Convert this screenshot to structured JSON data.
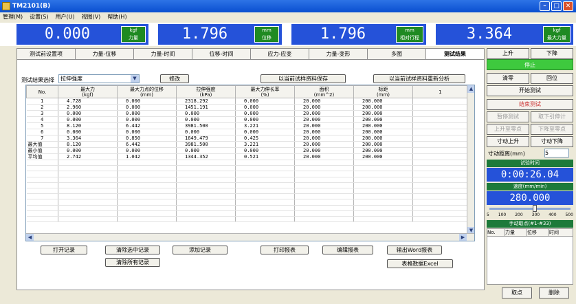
{
  "window": {
    "title": "TM2101(B)"
  },
  "menu": [
    "管理(M)",
    "设置(S)",
    "用户(U)",
    "视图(V)",
    "帮助(H)"
  ],
  "readouts": [
    {
      "value": "0.000",
      "unit_top": "kgf",
      "unit_bottom": "力量"
    },
    {
      "value": "1.796",
      "unit_top": "mm",
      "unit_bottom": "位移"
    },
    {
      "value": "1.796",
      "unit_top": "mm",
      "unit_bottom": "相对行程"
    },
    {
      "value": "3.364",
      "unit_top": "kgf",
      "unit_bottom": "最大力量"
    }
  ],
  "tabs": [
    "测试前设置项",
    "力量-位移",
    "力量-时间",
    "位移-时间",
    "应力-应变",
    "力量-变形",
    "多图",
    "测试结果"
  ],
  "active_tab": 7,
  "result_select": {
    "label": "测试结果选择",
    "value": "拉伸强度",
    "modify_button": "修改"
  },
  "top_buttons": {
    "save_params": "以当前试样资料保存",
    "reanalyze": "以当前试样资料重新分析"
  },
  "table": {
    "columns": [
      {
        "top": "No.",
        "bottom": ""
      },
      {
        "top": "最大力",
        "bottom": "(kgf)"
      },
      {
        "top": "最大力点的位移",
        "bottom": "(mm)"
      },
      {
        "top": "拉伸强度",
        "bottom": "(kPa)"
      },
      {
        "top": "最大力伸长率",
        "bottom": "(%)"
      },
      {
        "top": "面积",
        "bottom": "(mm^2)"
      },
      {
        "top": "标距",
        "bottom": "(mm)"
      },
      {
        "top": "1",
        "bottom": ""
      }
    ],
    "rows": [
      [
        "1",
        "4.728",
        "0.000",
        "2318.292",
        "0.000",
        "20.000",
        "200.000",
        ""
      ],
      [
        "2",
        "2.960",
        "0.000",
        "1451.191",
        "0.000",
        "20.000",
        "200.000",
        ""
      ],
      [
        "3",
        "0.000",
        "0.000",
        "0.000",
        "0.000",
        "20.000",
        "200.000",
        ""
      ],
      [
        "4",
        "0.000",
        "0.000",
        "0.000",
        "0.000",
        "20.000",
        "200.000",
        ""
      ],
      [
        "5",
        "8.120",
        "6.442",
        "3981.500",
        "3.221",
        "20.000",
        "200.000",
        ""
      ],
      [
        "6",
        "0.000",
        "0.000",
        "0.000",
        "0.000",
        "20.000",
        "200.000",
        ""
      ],
      [
        "7",
        "3.364",
        "0.850",
        "1649.479",
        "0.425",
        "20.000",
        "200.000",
        ""
      ],
      [
        "最大值",
        "8.120",
        "6.442",
        "3981.500",
        "3.221",
        "20.000",
        "200.000",
        ""
      ],
      [
        "最小值",
        "0.000",
        "0.000",
        "0.000",
        "0.000",
        "20.000",
        "200.000",
        ""
      ],
      [
        "平均值",
        "2.742",
        "1.042",
        "1344.352",
        "0.521",
        "20.000",
        "200.000",
        ""
      ]
    ]
  },
  "bottom_buttons": {
    "open_record": "打开记录",
    "clear_selected": "清除选中记录",
    "add_record": "添加记录",
    "print_report": "打印报表",
    "edit_report": "编辑报表",
    "export_word": "输出Word报表",
    "clear_all": "清除所有记录",
    "export_excel": "表格数据Excel"
  },
  "side": {
    "up": "上升",
    "down": "下降",
    "stop": "停止",
    "zero": "清零",
    "return": "回位",
    "start": "开始测试",
    "end": "结束测试",
    "pause": "暂停测试",
    "next_clamp": "取下引伸计",
    "up_point": "上升至零点",
    "down_point": "下降至零点",
    "jog_up": "寸动上升",
    "jog_down": "寸动下降",
    "jog_dist_label": "寸动距离(mm)",
    "jog_dist_value": "5",
    "time_label": "试验时间",
    "time_value": "0:00:26.04",
    "speed_label": "速度(mm/min)",
    "speed_value": "280.000",
    "speed_ticks": [
      "5",
      "100",
      "200",
      "300",
      "400",
      "500"
    ],
    "speed_fraction": 0.56,
    "manual_label": "手动取点(#1-#33)",
    "manual_cols": [
      "No.",
      "力量",
      "位移",
      "时间"
    ],
    "take_point": "取点",
    "delete": "删除"
  }
}
